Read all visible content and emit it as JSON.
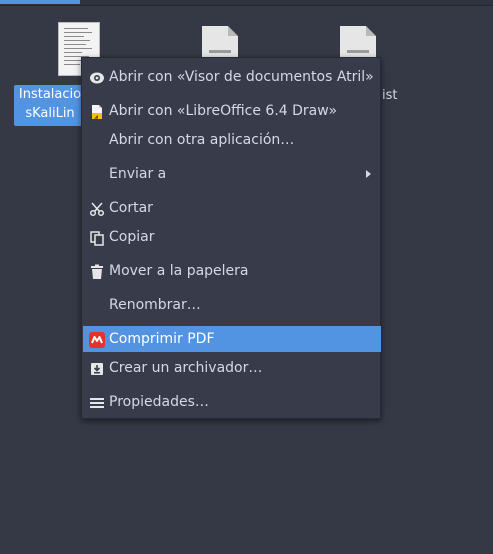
{
  "desktop": {
    "files": [
      {
        "label_line1": "Instalacio",
        "label_line2": "sKaliLin",
        "selected": true
      },
      {
        "label": ""
      },
      {
        "label": "ist"
      }
    ]
  },
  "context_menu": {
    "items": [
      {
        "label": "Abrir con «Visor de documentos Atril»",
        "icon": "eye-icon"
      },
      {
        "label": "Abrir con «LibreOffice 6.4 Draw»",
        "icon": "libreoffice-draw-icon"
      },
      {
        "label": "Abrir con otra aplicación…",
        "icon": ""
      },
      {
        "label": "Enviar a",
        "icon": "",
        "submenu": true
      },
      {
        "label": "Cortar",
        "icon": "scissors-icon"
      },
      {
        "label": "Copiar",
        "icon": "copy-icon"
      },
      {
        "label": "Mover a la papelera",
        "icon": "trash-icon"
      },
      {
        "label": "Renombrar…",
        "icon": ""
      },
      {
        "label": "Comprimir PDF",
        "icon": "compress-pdf-icon",
        "highlighted": true
      },
      {
        "label": "Crear un archivador…",
        "icon": "archive-icon"
      },
      {
        "label": "Propiedades…",
        "icon": "properties-icon"
      }
    ]
  },
  "colors": {
    "background": "#353945",
    "menu_bg": "#383c4a",
    "accent": "#5294e2",
    "text": "#d3dae3"
  }
}
